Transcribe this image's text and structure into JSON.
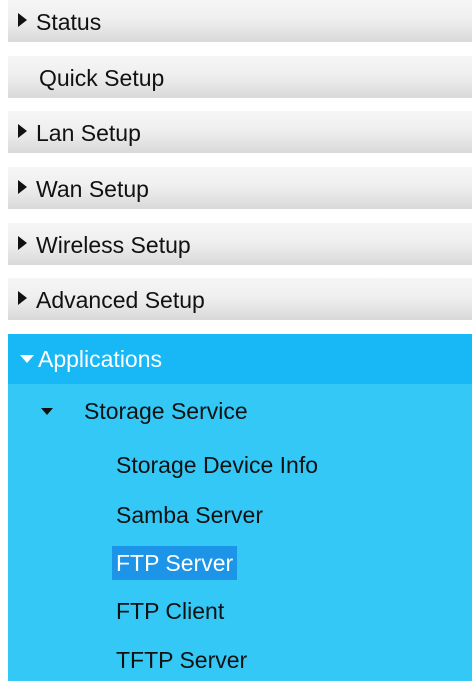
{
  "menu": {
    "status": "Status",
    "quick_setup": "Quick Setup",
    "lan_setup": "Lan Setup",
    "wan_setup": "Wan Setup",
    "wireless_setup": "Wireless Setup",
    "advanced_setup": "Advanced Setup",
    "applications": "Applications",
    "storage_service": "Storage Service",
    "storage_items": [
      "Storage Device Info",
      "Samba Server",
      "FTP Server",
      "FTP Client",
      "TFTP Server"
    ],
    "active_item": "FTP Server"
  },
  "colors": {
    "active_section_bg": "#18b8f6",
    "submenu_bg": "#34c8f7",
    "active_item_bg": "#1c94e8"
  }
}
